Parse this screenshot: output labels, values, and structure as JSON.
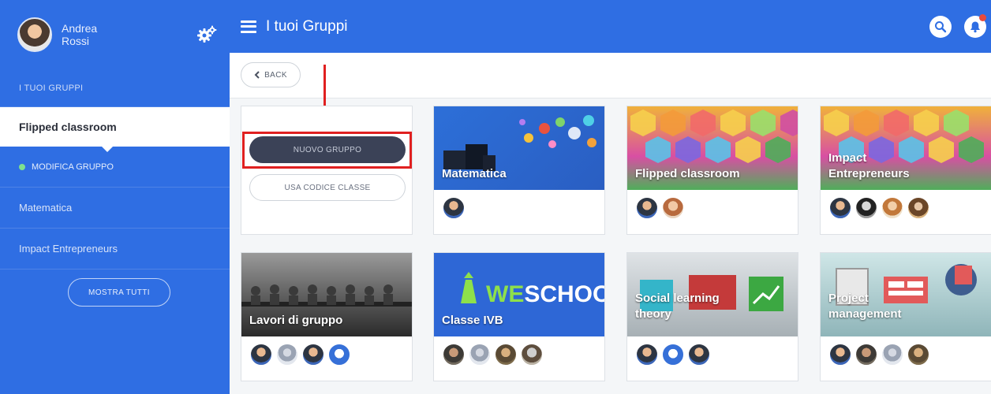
{
  "user": {
    "first_name": "Andrea",
    "last_name": "Rossi"
  },
  "sidebar": {
    "section_label": "I TUOI GRUPPI",
    "items": [
      {
        "label": "Flipped classroom"
      },
      {
        "label": "MODIFICA GRUPPO"
      },
      {
        "label": "Matematica"
      },
      {
        "label": "Impact Entrepreneurs"
      }
    ],
    "show_all_label": "MOSTRA TUTTI"
  },
  "header": {
    "title": "I tuoi Gruppi"
  },
  "subbar": {
    "back_label": "BACK"
  },
  "actions": {
    "new_group_label": "NUOVO GRUPPO",
    "use_code_label": "USA CODICE CLASSE"
  },
  "groups": [
    {
      "title": "Matematica"
    },
    {
      "title": "Flipped classroom"
    },
    {
      "title_line1": "Impact",
      "title_line2": "Entrepreneurs"
    },
    {
      "title": "Lavori di gruppo"
    },
    {
      "title": "Classe IVB",
      "brand_we": "WE",
      "brand_school": "SCHOOL"
    },
    {
      "title_line1": "Social learning",
      "title_line2": "theory"
    },
    {
      "title_line1": "Project",
      "title_line2": "management"
    }
  ],
  "colors": {
    "primary": "#2f6ee3",
    "dark_button": "#3b4257",
    "highlight": "#e02020"
  }
}
